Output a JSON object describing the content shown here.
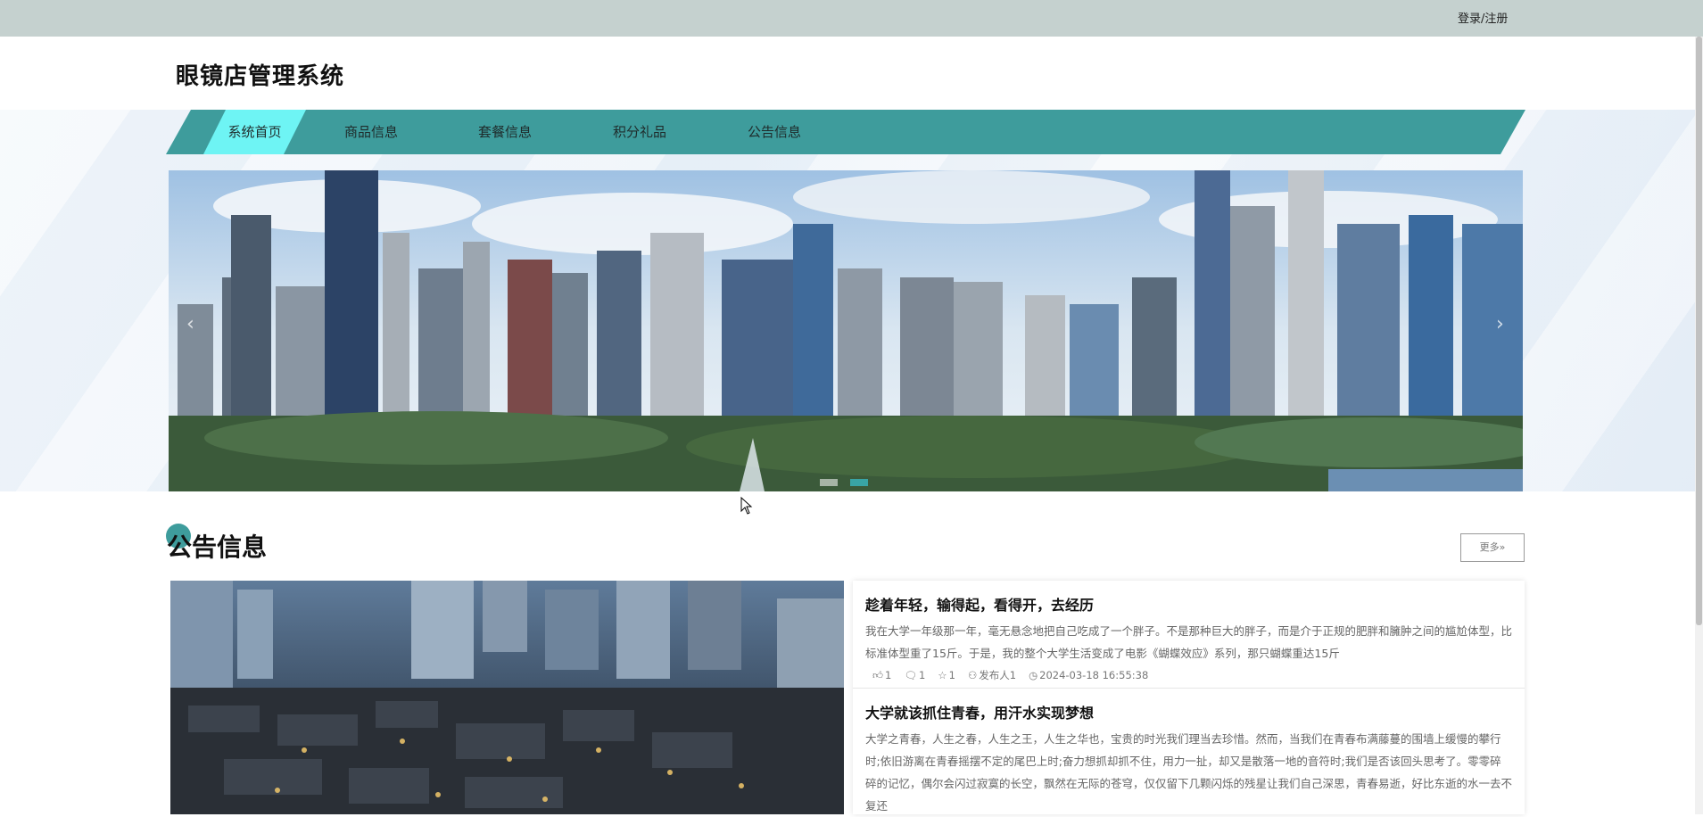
{
  "topbar": {
    "login_label": "登录/注册"
  },
  "header": {
    "site_title": "眼镜店管理系统"
  },
  "nav": {
    "items": [
      {
        "label": "系统首页",
        "active": true
      },
      {
        "label": "商品信息",
        "active": false
      },
      {
        "label": "套餐信息",
        "active": false
      },
      {
        "label": "积分礼品",
        "active": false
      },
      {
        "label": "公告信息",
        "active": false
      }
    ]
  },
  "banner": {
    "prev_icon": "chevron-left-icon",
    "next_icon": "chevron-right-icon",
    "slide_count": 2,
    "active_slide": 1
  },
  "notice_section": {
    "title": "公告信息",
    "more_label": "更多»",
    "items": [
      {
        "title": "趁着年轻，输得起，看得开，去经历",
        "desc": "我在大学一年级那一年，毫无悬念地把自己吃成了一个胖子。不是那种巨大的胖子，而是介于正规的肥胖和臃肿之间的尴尬体型，比标准体型重了15斤。于是，我的整个大学生活变成了电影《蝴蝶效应》系列，那只蝴蝶重达15斤",
        "likes": "1",
        "comments": "1",
        "favorites": "1",
        "publisher": "发布人1",
        "time": "2024-03-18 16:55:38"
      },
      {
        "title": "大学就该抓住青春，用汗水实现梦想",
        "desc": "大学之青春，人生之春，人生之王，人生之华也，宝贵的时光我们理当去珍惜。然而，当我们在青春布满藤蔓的围墙上缓慢的攀行时;依旧游离在青春摇摆不定的尾巴上时;奋力想抓却抓不住，用力一扯，却又是散落一地的音符时;我们是否该回头思考了。零零碎碎的记忆，偶尔会闪过寂寞的长空，飘然在无际的苍穹，仅仅留下几颗闪烁的残星让我们自己深思，青春易逝，好比东逝的水一去不复还"
      }
    ]
  },
  "colors": {
    "accent": "#3e9c9c",
    "nav_active": "#6ef4f4",
    "topbar": "#c5d1cf"
  }
}
